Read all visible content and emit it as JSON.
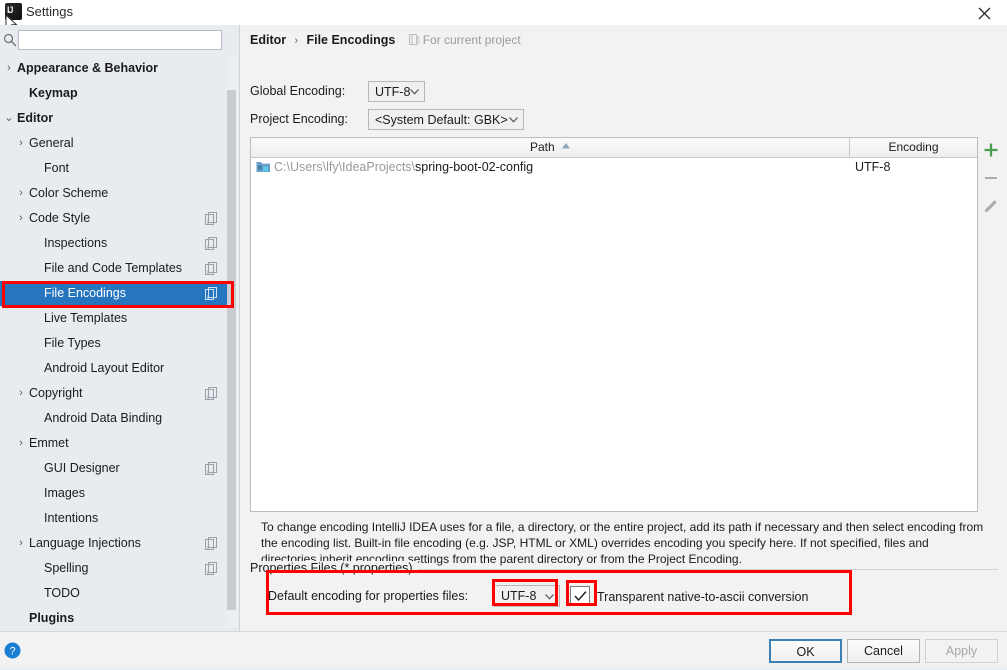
{
  "window": {
    "title": "Settings",
    "app_icon": "intellij-idea-icon",
    "close_icon": "close-icon"
  },
  "sidebar": {
    "search": {
      "placeholder": "",
      "value": "",
      "icon": "search-icon"
    },
    "items": [
      {
        "label": "Appearance & Behavior",
        "indent": 5,
        "arrow": "›",
        "bold": true,
        "scope_icon": false,
        "selected": false
      },
      {
        "label": "Keymap",
        "indent": 17,
        "arrow": "",
        "bold": true,
        "scope_icon": false,
        "selected": false
      },
      {
        "label": "Editor",
        "indent": 5,
        "arrow": "⌄",
        "bold": true,
        "scope_icon": false,
        "selected": false
      },
      {
        "label": "General",
        "indent": 17,
        "arrow": "›",
        "bold": false,
        "scope_icon": false,
        "selected": false
      },
      {
        "label": "Font",
        "indent": 32,
        "arrow": "",
        "bold": false,
        "scope_icon": false,
        "selected": false
      },
      {
        "label": "Color Scheme",
        "indent": 17,
        "arrow": "›",
        "bold": false,
        "scope_icon": false,
        "selected": false
      },
      {
        "label": "Code Style",
        "indent": 17,
        "arrow": "›",
        "bold": false,
        "scope_icon": true,
        "selected": false
      },
      {
        "label": "Inspections",
        "indent": 32,
        "arrow": "",
        "bold": false,
        "scope_icon": true,
        "selected": false
      },
      {
        "label": "File and Code Templates",
        "indent": 32,
        "arrow": "",
        "bold": false,
        "scope_icon": true,
        "selected": false
      },
      {
        "label": "File Encodings",
        "indent": 32,
        "arrow": "",
        "bold": false,
        "scope_icon": true,
        "selected": true
      },
      {
        "label": "Live Templates",
        "indent": 32,
        "arrow": "",
        "bold": false,
        "scope_icon": false,
        "selected": false
      },
      {
        "label": "File Types",
        "indent": 32,
        "arrow": "",
        "bold": false,
        "scope_icon": false,
        "selected": false
      },
      {
        "label": "Android Layout Editor",
        "indent": 32,
        "arrow": "",
        "bold": false,
        "scope_icon": false,
        "selected": false
      },
      {
        "label": "Copyright",
        "indent": 17,
        "arrow": "›",
        "bold": false,
        "scope_icon": true,
        "selected": false
      },
      {
        "label": "Android Data Binding",
        "indent": 32,
        "arrow": "",
        "bold": false,
        "scope_icon": false,
        "selected": false
      },
      {
        "label": "Emmet",
        "indent": 17,
        "arrow": "›",
        "bold": false,
        "scope_icon": false,
        "selected": false
      },
      {
        "label": "GUI Designer",
        "indent": 32,
        "arrow": "",
        "bold": false,
        "scope_icon": true,
        "selected": false
      },
      {
        "label": "Images",
        "indent": 32,
        "arrow": "",
        "bold": false,
        "scope_icon": false,
        "selected": false
      },
      {
        "label": "Intentions",
        "indent": 32,
        "arrow": "",
        "bold": false,
        "scope_icon": false,
        "selected": false
      },
      {
        "label": "Language Injections",
        "indent": 17,
        "arrow": "›",
        "bold": false,
        "scope_icon": true,
        "selected": false
      },
      {
        "label": "Spelling",
        "indent": 32,
        "arrow": "",
        "bold": false,
        "scope_icon": true,
        "selected": false
      },
      {
        "label": "TODO",
        "indent": 32,
        "arrow": "",
        "bold": false,
        "scope_icon": false,
        "selected": false
      },
      {
        "label": "Plugins",
        "indent": 17,
        "arrow": "",
        "bold": true,
        "scope_icon": false,
        "selected": false
      }
    ]
  },
  "main": {
    "breadcrumb": {
      "parent": "Editor",
      "separator": "›",
      "current": "File Encodings",
      "hint": "For current project",
      "hint_icon": "project-scope-icon"
    },
    "global_encoding": {
      "label": "Global Encoding:",
      "value": "UTF-8"
    },
    "project_encoding": {
      "label": "Project Encoding:",
      "value": "<System Default: GBK>"
    },
    "table": {
      "columns": [
        "Path",
        "Encoding"
      ],
      "sort_column": "Path",
      "sort_arrow": "▲",
      "rows": [
        {
          "icon": "module-folder-icon",
          "path_prefix": "C:\\Users\\lfy\\IdeaProjects\\",
          "path_name": "spring-boot-02-config",
          "encoding": "UTF-8"
        }
      ]
    },
    "table_toolbar": [
      {
        "name": "add-path-button",
        "icon": "plus-icon",
        "enabled": true
      },
      {
        "name": "remove-path-button",
        "icon": "minus-icon",
        "enabled": false
      },
      {
        "name": "edit-path-button",
        "icon": "pencil-icon",
        "enabled": false
      }
    ],
    "description": "To change encoding IntelliJ IDEA uses for a file, a directory, or the entire project, add its path if necessary and then select encoding from the encoding list. Built-in file encoding (e.g. JSP, HTML or XML) overrides encoding you specify here. If not specified, files and directories inherit encoding settings from the parent directory or from the Project Encoding.",
    "properties_group": {
      "title": "Properties Files (*.properties)",
      "default_encoding_label": "Default encoding for properties files:",
      "default_encoding_value": "UTF-8",
      "transparent_checkbox_label": "Transparent native-to-ascii conversion",
      "transparent_checkbox_checked": true
    }
  },
  "footer": {
    "help_icon": "help-icon",
    "ok_label": "OK",
    "cancel_label": "Cancel",
    "apply_label": "Apply",
    "apply_enabled": false
  },
  "annotations": {
    "highlight_color": "#ff0000",
    "boxes": [
      "sidebar-file-encodings",
      "properties-files-row",
      "properties-encoding-combo",
      "transparent-checkbox"
    ]
  }
}
